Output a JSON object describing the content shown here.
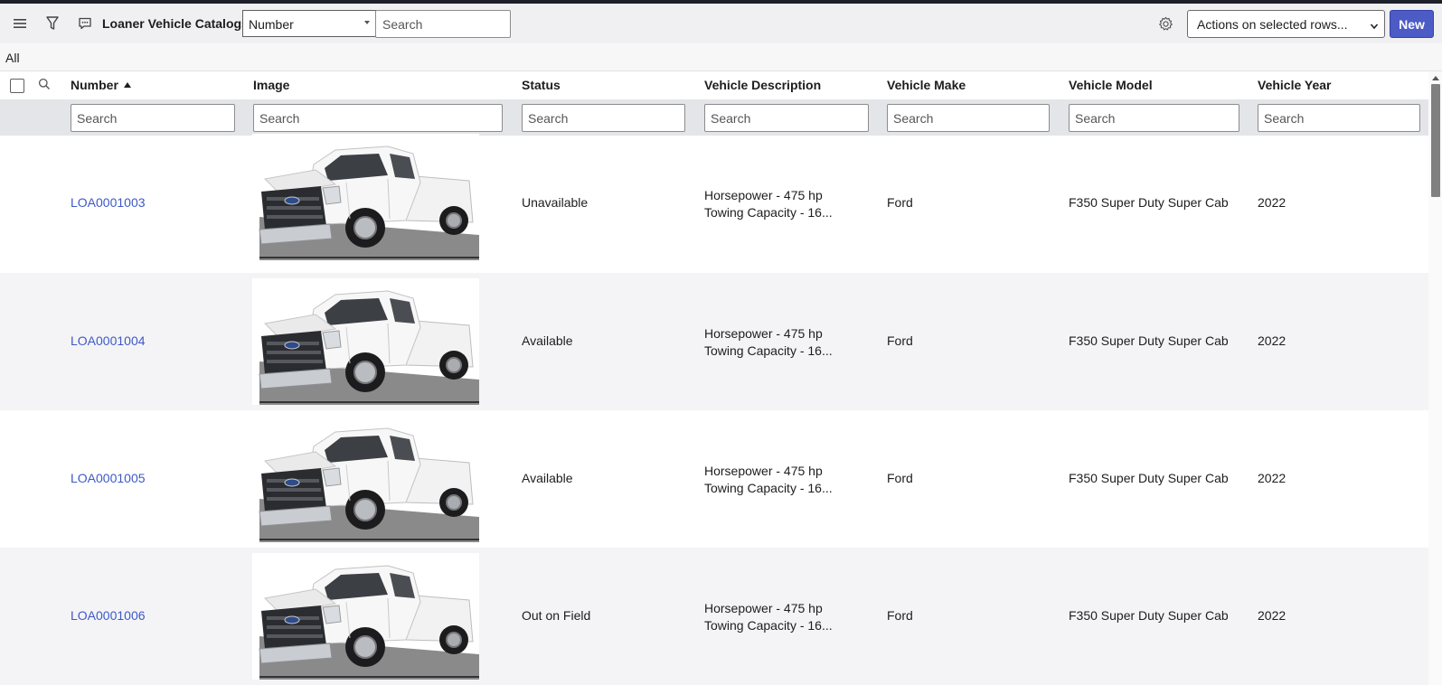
{
  "toolbar": {
    "title": "Loaner Vehicle Catalogs",
    "field_select_value": "Number",
    "search_placeholder": "Search",
    "actions_label": "Actions on selected rows...",
    "new_label": "New"
  },
  "breadcrumb": "All",
  "columns": [
    {
      "label": "Number",
      "sorted": "ascending"
    },
    {
      "label": "Image"
    },
    {
      "label": "Status"
    },
    {
      "label": "Vehicle Description"
    },
    {
      "label": "Vehicle Make"
    },
    {
      "label": "Vehicle Model"
    },
    {
      "label": "Vehicle Year"
    }
  ],
  "filter_placeholder": "Search",
  "rows": [
    {
      "number": "LOA0001003",
      "status": "Unavailable",
      "desc_line1": "Horsepower - 475 hp",
      "desc_line2": "Towing Capacity - 16...",
      "make": "Ford",
      "model": "F350 Super Duty Super Cab",
      "year": "2022"
    },
    {
      "number": "LOA0001004",
      "status": "Available",
      "desc_line1": "Horsepower - 475 hp",
      "desc_line2": "Towing Capacity - 16...",
      "make": "Ford",
      "model": "F350 Super Duty Super Cab",
      "year": "2022"
    },
    {
      "number": "LOA0001005",
      "status": "Available",
      "desc_line1": "Horsepower - 475 hp",
      "desc_line2": "Towing Capacity - 16...",
      "make": "Ford",
      "model": "F350 Super Duty Super Cab",
      "year": "2022"
    },
    {
      "number": "LOA0001006",
      "status": "Out on Field",
      "desc_line1": "Horsepower - 475 hp",
      "desc_line2": "Towing Capacity - 16...",
      "make": "Ford",
      "model": "F350 Super Duty Super Cab",
      "year": "2022"
    }
  ],
  "colors": {
    "link": "#3d59c7",
    "primary_button": "#4c5bc5",
    "filter_row": "#e4e5e9",
    "alt_row": "#f4f4f6"
  },
  "icons": [
    "menu-icon",
    "filter-icon",
    "comment-icon",
    "settings-gear-icon",
    "search-icon",
    "chevron-down-icon",
    "sort-ascending-icon"
  ]
}
